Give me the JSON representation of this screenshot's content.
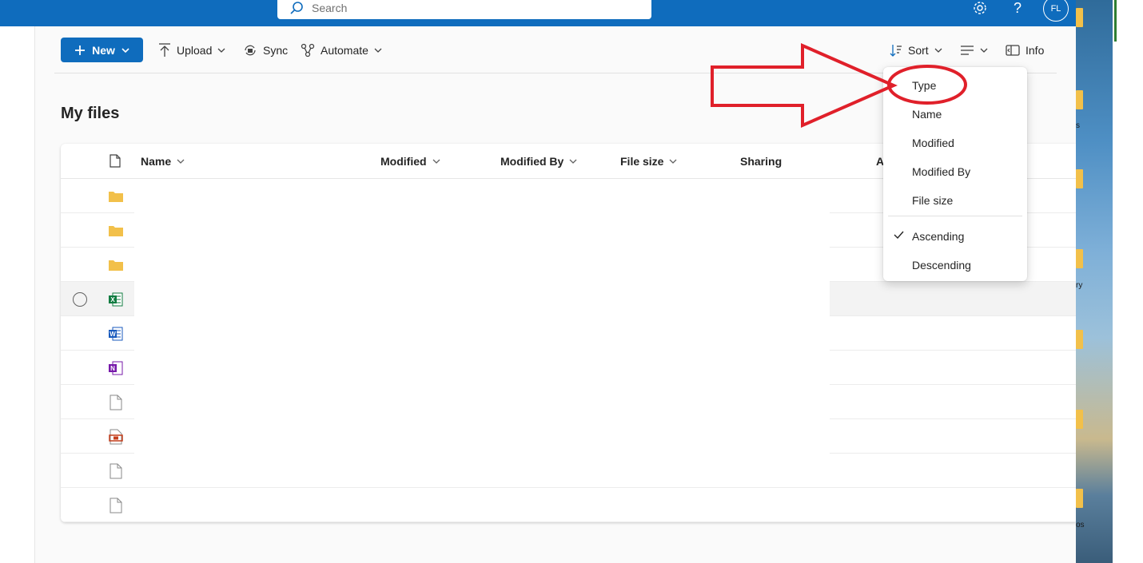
{
  "header": {
    "search_placeholder": "Search",
    "avatar_initials": "FL",
    "settings_icon": "gear-icon",
    "help_icon": "question-icon"
  },
  "commandbar": {
    "new_label": "New",
    "upload_label": "Upload",
    "sync_label": "Sync",
    "automate_label": "Automate",
    "sort_label": "Sort",
    "info_label": "Info"
  },
  "page": {
    "title": "My files"
  },
  "table": {
    "columns": [
      "Name",
      "Modified",
      "Modified By",
      "File size",
      "Sharing",
      "A"
    ],
    "rows": [
      {
        "type": "folder"
      },
      {
        "type": "folder"
      },
      {
        "type": "folder"
      },
      {
        "type": "excel",
        "selected": true
      },
      {
        "type": "word"
      },
      {
        "type": "onenote"
      },
      {
        "type": "generic"
      },
      {
        "type": "media"
      },
      {
        "type": "generic"
      },
      {
        "type": "generic"
      }
    ]
  },
  "sort_menu": {
    "items": [
      "Type",
      "Name",
      "Modified",
      "Modified By",
      "File size"
    ],
    "order_items": [
      "Ascending",
      "Descending"
    ],
    "checked": "Ascending"
  },
  "annotation": {
    "arrow_color": "#e0202a",
    "highlight": "Type"
  },
  "desktop": {
    "label_fragments": [
      "s",
      "ry",
      "os"
    ]
  },
  "colors": {
    "brand": "#0f6cbd",
    "folder": "#f2c04a",
    "excel": "#107c41",
    "word": "#185abd",
    "onenote": "#7719aa",
    "media": "#c43e1c"
  }
}
